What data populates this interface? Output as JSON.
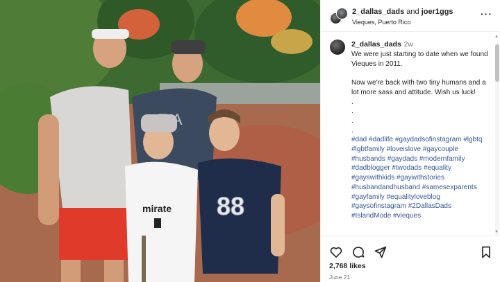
{
  "photo": {
    "description_icon": "family-photo",
    "jerseys": {
      "left_kid_number": "",
      "right_kid_number": "88",
      "left_kid_sponsor": "Emirate"
    }
  },
  "header": {
    "user1": "2_dallas_dads",
    "and_text": "and",
    "user2": "joer1ggs",
    "location": "Vieques, Puerto Rico",
    "more_icon": "more-horizontal-icon",
    "more_label": "···"
  },
  "caption": {
    "username": "2_dallas_dads",
    "time": "2w",
    "paragraph1": "We were just starting to date when we found Vieques in 2011.",
    "paragraph2": "Now we're back with two tiny humans and a lot more sass and attitude. Wish us luck!",
    "dots": [
      ".",
      ".",
      ".",
      "."
    ],
    "hashtags": [
      "#dad",
      "#dadlife",
      "#gaydadsofinstagram",
      "#lgbtq",
      "#lgbtfamily",
      "#loveislove",
      "#gaycouple",
      "#husbands",
      "#gaydads",
      "#modernfamily",
      "#dadblogger",
      "#twodads",
      "#equality",
      "#gayswithkids",
      "#gaywithstories",
      "#husbandandhusband",
      "#samesexparents",
      "#gayfamily",
      "#equalityloveblog",
      "#gaysofinstagram",
      "#2DallasDads",
      "#IslandMode",
      "#vieques"
    ]
  },
  "actions": {
    "like_icon": "heart-icon",
    "comment_icon": "comment-icon",
    "share_icon": "send-icon",
    "save_icon": "bookmark-icon"
  },
  "likes": "2,768 likes",
  "date": "June 21",
  "colors": {
    "hashtag": "#385898",
    "text": "#262626",
    "muted": "#737373"
  }
}
